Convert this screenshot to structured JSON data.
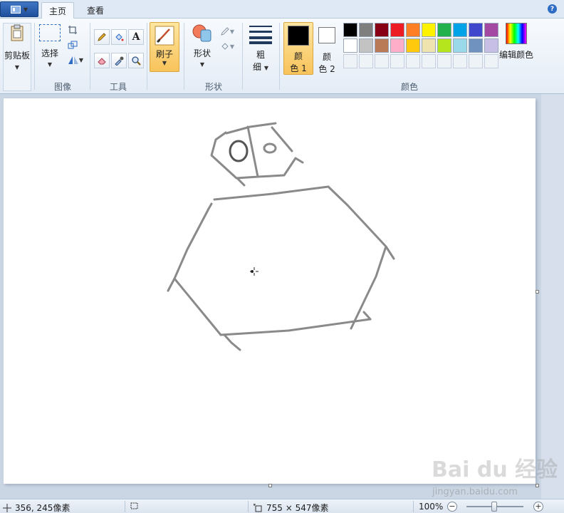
{
  "tabs": {
    "home": "主页",
    "view": "查看"
  },
  "clipboard": {
    "label": "剪贴板",
    "group": ""
  },
  "image": {
    "select_label": "选择",
    "group": "图像"
  },
  "tools": {
    "group": "工具",
    "text_tool": "A"
  },
  "brush": {
    "label": "刷子"
  },
  "shapes": {
    "label": "形状",
    "group": "形状"
  },
  "size": {
    "label_line1": "粗",
    "label_line2": "细"
  },
  "colors": {
    "color1_line1": "颜",
    "color1_line2": "色 1",
    "color2_line1": "颜",
    "color2_line2": "色 2",
    "group": "颜色",
    "edit_label": "编辑颜色",
    "color1_value": "#000000",
    "color2_value": "#ffffff",
    "palette_row1": [
      "#000000",
      "#7f7f7f",
      "#880015",
      "#ed1c24",
      "#ff7f27",
      "#fff200",
      "#22b14c",
      "#00a2e8",
      "#3f48cc",
      "#a349a4"
    ],
    "palette_row2": [
      "#ffffff",
      "#c3c3c3",
      "#b97a57",
      "#ffaec9",
      "#ffc90e",
      "#efe4b0",
      "#b5e61d",
      "#99d9ea",
      "#7092be",
      "#c8bfe7"
    ]
  },
  "status": {
    "cursor_pos": "356, 245像素",
    "selection_size": "",
    "image_size": "755 × 547像素",
    "zoom": "100%"
  },
  "watermark": {
    "brand": "Bai du 经验",
    "url": "jingyan.baidu.com"
  },
  "icons": {
    "app_menu": "window-menu-icon",
    "help": "help-icon",
    "paste": "paste-icon"
  }
}
